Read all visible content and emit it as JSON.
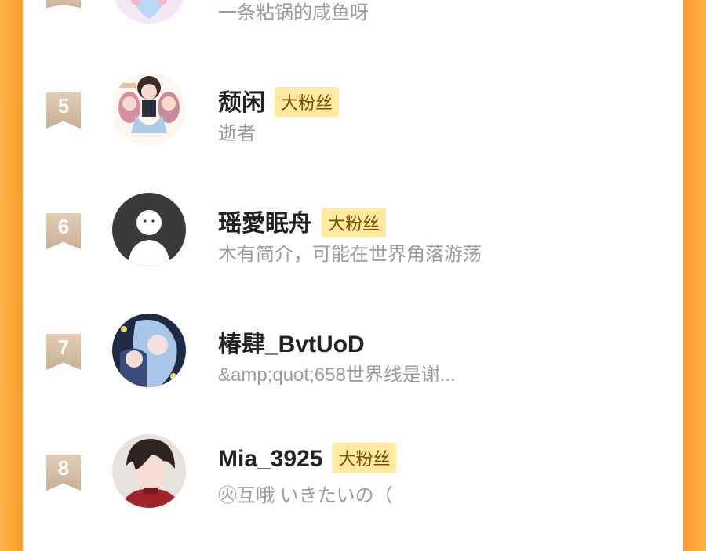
{
  "rows": [
    {
      "rank": "",
      "name": "",
      "badge": "",
      "desc": "一条粘锅的咸鱼呀"
    },
    {
      "rank": "5",
      "name": "颓闲",
      "badge": "大粉丝",
      "desc": "逝者"
    },
    {
      "rank": "6",
      "name": "瑶愛眠舟",
      "badge": "大粉丝",
      "desc": "木有简介，可能在世界角落游荡"
    },
    {
      "rank": "7",
      "name": "椿肆_BvtUoD",
      "badge": "",
      "desc": "&amp;quot;658世界线是谢..."
    },
    {
      "rank": "8",
      "name": "Mia_3925",
      "badge": "大粉丝",
      "desc": "㊋互哦 いきたいの（"
    }
  ],
  "colors": {
    "background_orange": "#ff9d2c",
    "badge_bg": "#ffeaa0",
    "rank_badge": "#c9b096"
  }
}
